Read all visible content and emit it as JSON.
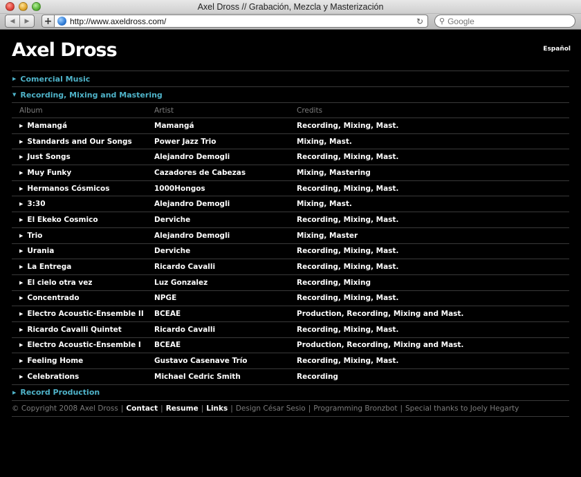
{
  "window": {
    "title": "Axel Dross // Grabación, Mezcla y Masterización"
  },
  "toolbar": {
    "back_icon": "back-arrow-icon",
    "forward_icon": "forward-arrow-icon",
    "add_icon": "plus-icon",
    "url": "http://www.axeldross.com/",
    "reload_glyph": "↻",
    "search_placeholder": "Google"
  },
  "site": {
    "title": "Axel Dross",
    "language_link": "Español"
  },
  "sections": [
    {
      "label": "Comercial Music",
      "expanded": false
    },
    {
      "label": "Recording, Mixing and Mastering",
      "expanded": true
    },
    {
      "label": "Record Production",
      "expanded": false
    }
  ],
  "table": {
    "headers": {
      "album": "Album",
      "artist": "Artist",
      "credits": "Credits"
    },
    "rows": [
      {
        "album": "Mamangá",
        "artist": "Mamangá",
        "credits": "Recording, Mixing, Mast."
      },
      {
        "album": "Standards and Our Songs",
        "artist": "Power Jazz Trio",
        "credits": "Mixing, Mast."
      },
      {
        "album": "Just Songs",
        "artist": "Alejandro Demogli",
        "credits": "Recording, Mixing, Mast."
      },
      {
        "album": "Muy Funky",
        "artist": "Cazadores de Cabezas",
        "credits": "Mixing, Mastering"
      },
      {
        "album": "Hermanos Cósmicos",
        "artist": "1000Hongos",
        "credits": "Recording, Mixing, Mast."
      },
      {
        "album": "3:30",
        "artist": "Alejandro Demogli",
        "credits": "Mixing, Mast."
      },
      {
        "album": "El Ekeko Cosmico",
        "artist": "Derviche",
        "credits": "Recording, Mixing, Mast."
      },
      {
        "album": "Trio",
        "artist": "Alejandro Demogli",
        "credits": "Mixing, Master"
      },
      {
        "album": "Urania",
        "artist": "Derviche",
        "credits": "Recording, Mixing, Mast."
      },
      {
        "album": "La Entrega",
        "artist": "Ricardo Cavalli",
        "credits": "Recording, Mixing, Mast."
      },
      {
        "album": "El cielo otra vez",
        "artist": "Luz Gonzalez",
        "credits": "Recording, Mixing"
      },
      {
        "album": "Concentrado",
        "artist": "NPGE",
        "credits": "Recording, Mixing, Mast."
      },
      {
        "album": "Electro Acoustic-Ensemble II",
        "artist": "BCEAE",
        "credits": "Production, Recording, Mixing and Mast."
      },
      {
        "album": "Ricardo Cavalli Quintet",
        "artist": "Ricardo Cavalli",
        "credits": "Recording, Mixing, Mast."
      },
      {
        "album": "Electro Acoustic-Ensemble I",
        "artist": "BCEAE",
        "credits": "Production, Recording, Mixing and Mast."
      },
      {
        "album": "Feeling Home",
        "artist": "Gustavo Casenave Trío",
        "credits": "Recording, Mixing, Mast."
      },
      {
        "album": "Celebrations",
        "artist": "Michael Cedric Smith",
        "credits": "Recording"
      }
    ]
  },
  "footer": {
    "copyright": "© Copyright 2008 Axel Dross",
    "contact": "Contact",
    "resume": "Resume",
    "links": "Links",
    "design": "Design César Sesio",
    "programming": "Programming Bronzbot",
    "thanks": "Special thanks to Joely Hegarty"
  },
  "colors": {
    "accent": "#4fb3c9",
    "background": "#000000",
    "divider": "#3a3a3a",
    "muted": "#7d7d7d"
  }
}
